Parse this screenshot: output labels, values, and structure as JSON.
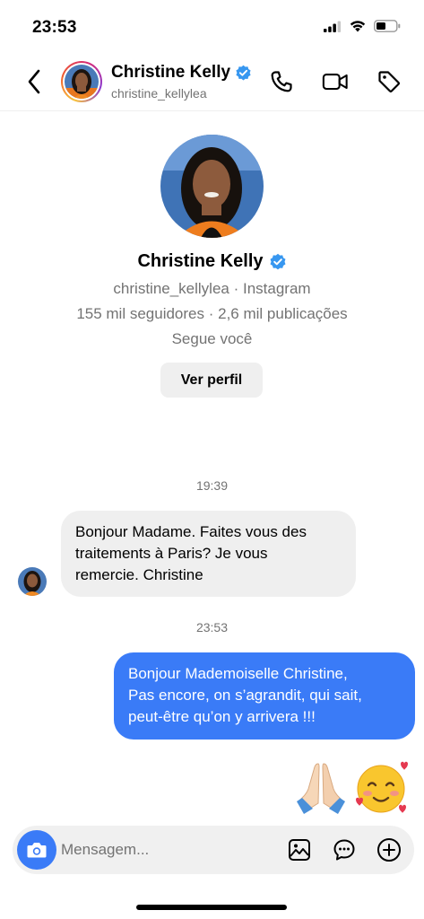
{
  "status_bar": {
    "time": "23:53"
  },
  "header": {
    "name": "Christine Kelly",
    "username": "christine_kellylea",
    "icons": [
      "back-arrow-icon",
      "phone-icon",
      "video-icon",
      "tag-icon"
    ]
  },
  "profile": {
    "name": "Christine Kelly",
    "subtitle": "christine_kellylea · Instagram",
    "stats": "155 mil seguidores · 2,6 mil publicações",
    "follows_you": "Segue você",
    "view_profile_label": "Ver perfil"
  },
  "thread": {
    "timestamp_1": "19:39",
    "incoming_message": {
      "lines": [
        "Bonjour Madame. Faites vous des",
        "traitements à Paris? Je vous",
        "remercie. Christine"
      ]
    },
    "timestamp_2": "23:53",
    "outgoing_message": {
      "lines": [
        "Bonjour Mademoiselle Christine,",
        "Pas encore, on s’agrandit, qui sait,",
        "peut-être qu’on y arrivera !!!"
      ]
    },
    "emoji": "🙏🏻🥰"
  },
  "composer": {
    "placeholder": "Mensagem...",
    "icons": [
      "camera-icon",
      "gallery-icon",
      "sticker-icon",
      "plus-circle-icon"
    ]
  },
  "colors": {
    "accent_blue": "#3a7bf7",
    "verified_blue": "#3797f0",
    "bubble_gray": "#efefef",
    "muted_text": "#737373"
  }
}
